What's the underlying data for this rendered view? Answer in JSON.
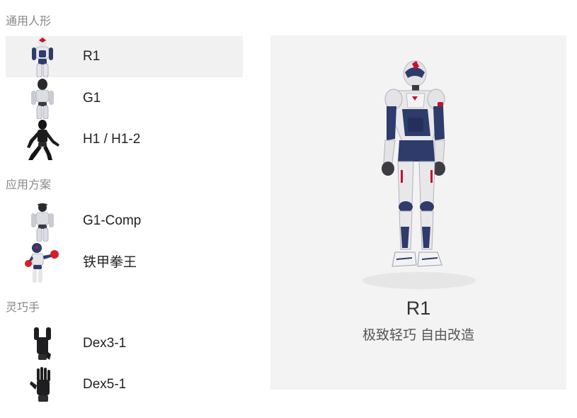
{
  "menu": {
    "groups": [
      {
        "title": "通用人形",
        "items": [
          {
            "label": "R1",
            "icon": "robot-r1-icon"
          },
          {
            "label": "G1",
            "icon": "robot-g1-icon"
          },
          {
            "label": "H1 / H1-2",
            "icon": "robot-h1-icon"
          }
        ]
      },
      {
        "title": "应用方案",
        "items": [
          {
            "label": "G1-Comp",
            "icon": "robot-g1-comp-icon"
          },
          {
            "label": "铁甲拳王",
            "icon": "boxing-robot-icon"
          }
        ]
      },
      {
        "title": "灵巧手",
        "items": [
          {
            "label": "Dex3-1",
            "icon": "dexterous-hand-dex3-icon"
          },
          {
            "label": "Dex5-1",
            "icon": "dexterous-hand-dex5-icon"
          }
        ]
      }
    ],
    "selected": "R1"
  },
  "preview": {
    "name": "R1",
    "description": "极致轻巧 自由改造",
    "image": "robot-r1-full-body"
  },
  "colors": {
    "active_bg": "#f1f1f1",
    "panel_bg": "#f3f3f3",
    "group_title": "#888888",
    "robot_navy": "#2e3b6b",
    "robot_white": "#e8e8ea",
    "accent_red": "#c8102e"
  }
}
